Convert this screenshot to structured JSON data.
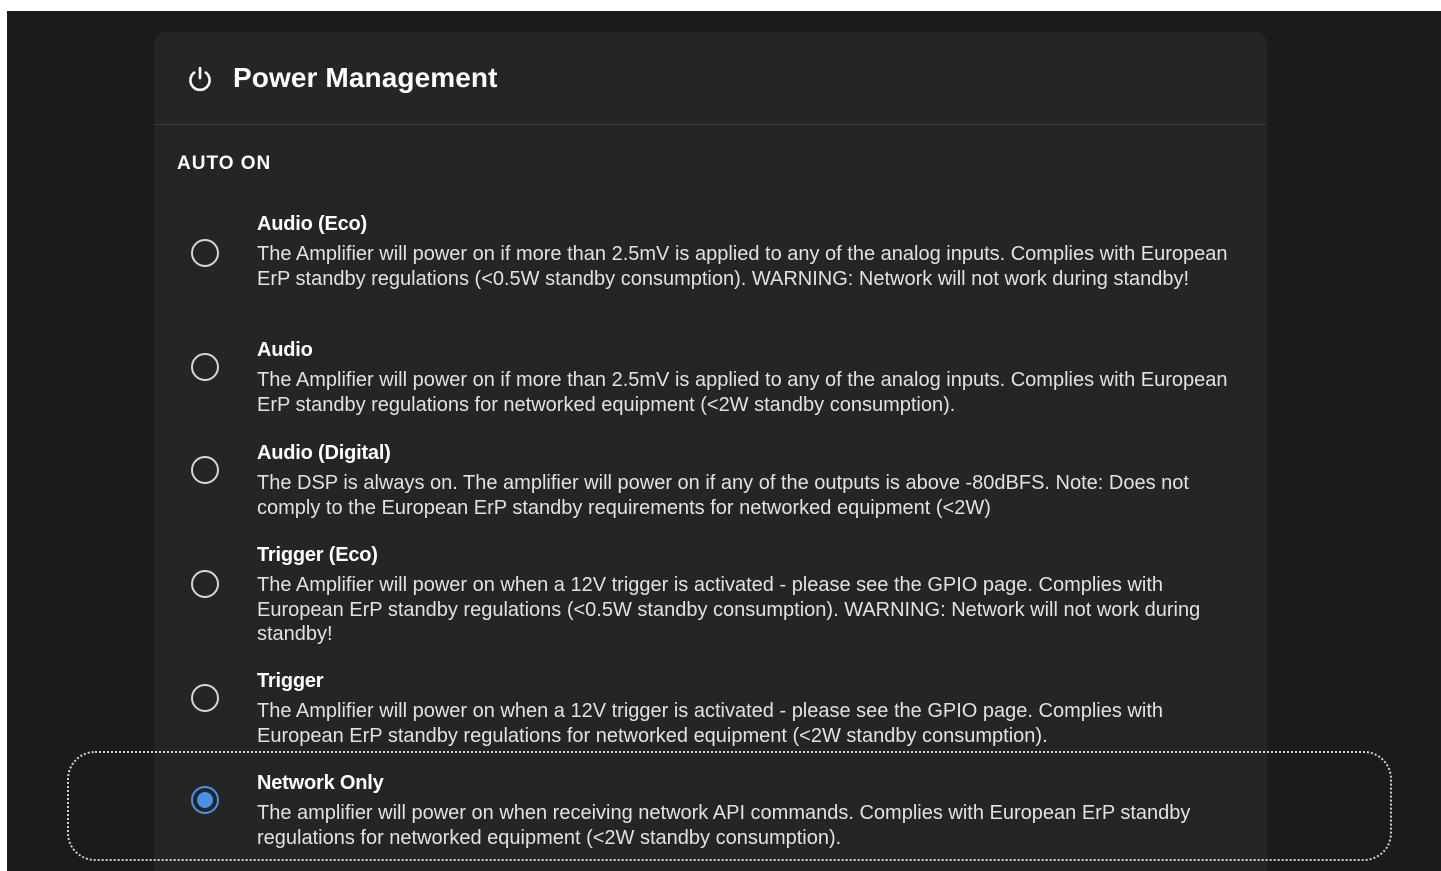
{
  "card": {
    "title": "Power Management",
    "icon": "power-icon"
  },
  "section": {
    "label": "AUTO ON"
  },
  "colors": {
    "accent": "#4a90e8",
    "background": "#1b1b1b",
    "card": "#252525"
  },
  "selected_option": "Network Only",
  "options": [
    {
      "title": "Audio (Eco)",
      "description": "The Amplifier will power on if more than 2.5mV is applied to any of the analog inputs. Complies with European ErP standby regulations (<0.5W standby consumption). WARNING: Network will not work during standby!"
    },
    {
      "title": "Audio",
      "description": "The Amplifier will power on if more than 2.5mV is applied to any of the analog inputs. Complies with European ErP standby regulations for networked equipment (<2W standby consumption)."
    },
    {
      "title": "Audio (Digital)",
      "description": "The DSP is always on. The amplifier will power on if any of the outputs is above -80dBFS. Note: Does not comply to the European ErP standby requirements for networked equipment (<2W)"
    },
    {
      "title": "Trigger (Eco)",
      "description": "The Amplifier will power on when a 12V trigger is activated - please see the GPIO page. Complies with European ErP standby regulations (<0.5W standby consumption). WARNING: Network will not work during standby!"
    },
    {
      "title": "Trigger",
      "description": "The Amplifier will power on when a 12V trigger is activated - please see the GPIO page. Complies with European ErP standby regulations for networked equipment (<2W standby consumption)."
    },
    {
      "title": "Network Only",
      "description": "The amplifier will power on when receiving network API commands. Complies with European ErP standby regulations for networked equipment (<2W standby consumption)."
    }
  ]
}
